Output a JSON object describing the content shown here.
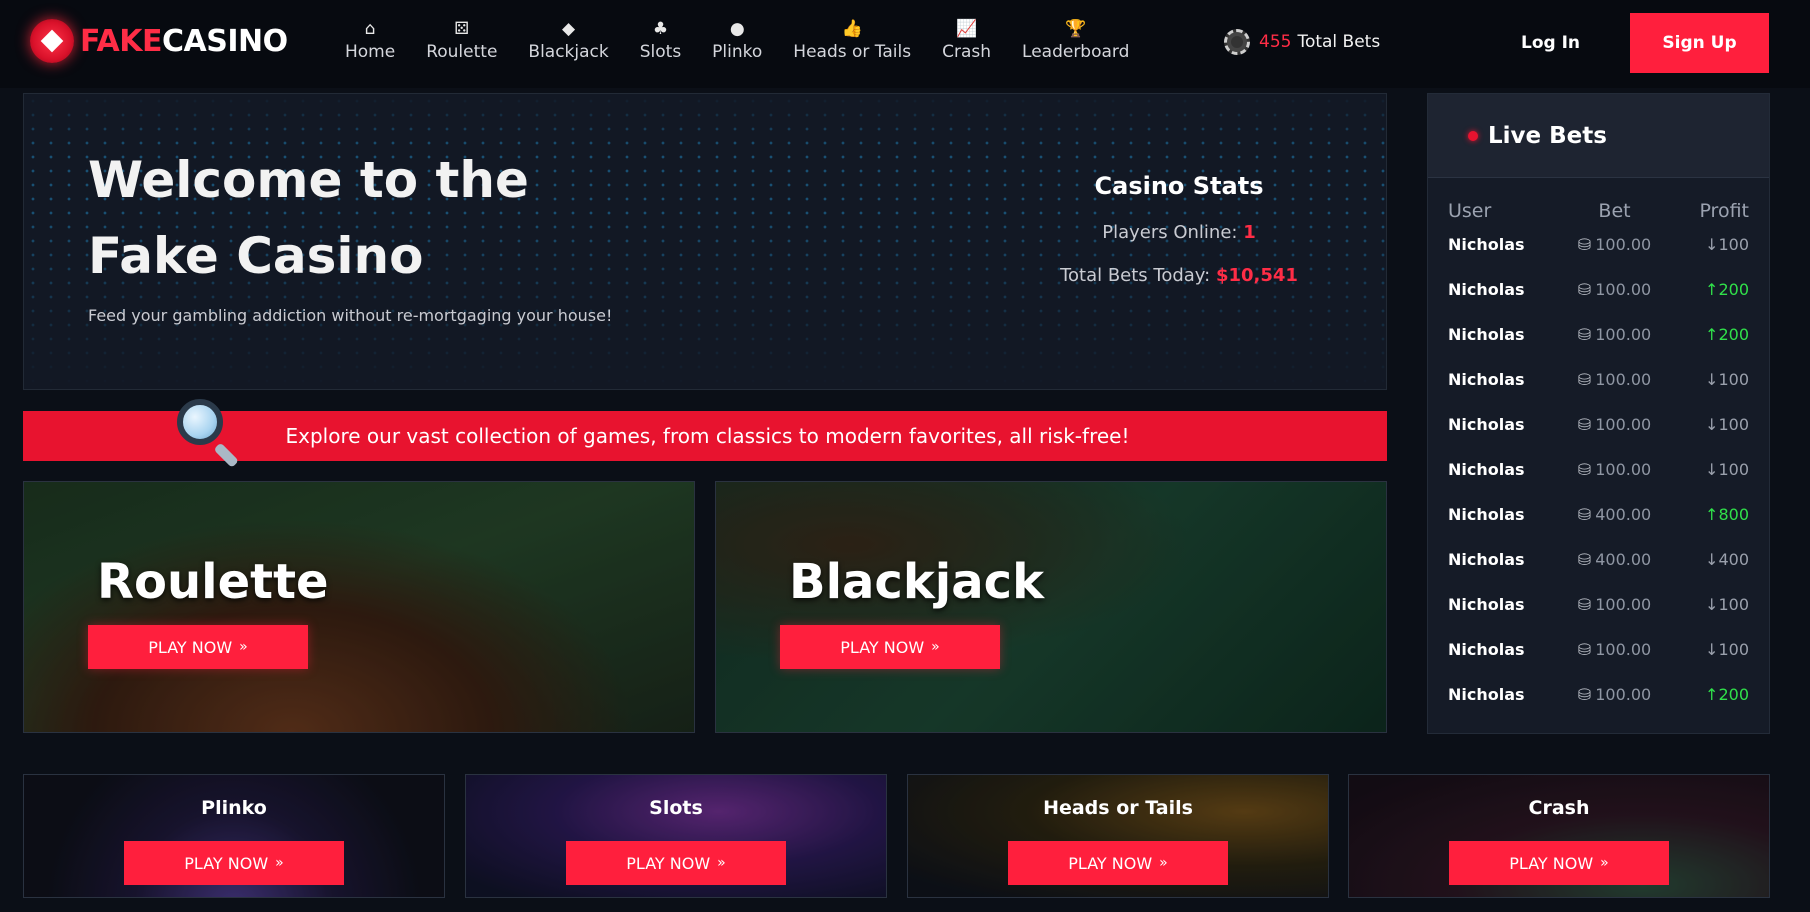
{
  "brand": {
    "part1": "FAKE",
    "part2": "CASINO"
  },
  "nav": [
    {
      "icon": "home-icon",
      "glyph": "⌂",
      "label": "Home"
    },
    {
      "icon": "dice-icon",
      "glyph": "⚄",
      "label": "Roulette"
    },
    {
      "icon": "diamond-icon",
      "glyph": "◆",
      "label": "Blackjack"
    },
    {
      "icon": "club-icon",
      "glyph": "♣",
      "label": "Slots"
    },
    {
      "icon": "circle-icon",
      "glyph": "●",
      "label": "Plinko"
    },
    {
      "icon": "thumbs-up-icon",
      "glyph": "👍",
      "label": "Heads or Tails"
    },
    {
      "icon": "chart-icon",
      "glyph": "📈",
      "label": "Crash"
    },
    {
      "icon": "trophy-icon",
      "glyph": "🏆",
      "label": "Leaderboard"
    }
  ],
  "header": {
    "total_bets_count": "455",
    "total_bets_label": "Total Bets",
    "login_label": "Log In",
    "signup_label": "Sign Up"
  },
  "hero": {
    "title": "Welcome to the Fake Casino",
    "subtitle": "Feed your gambling addiction without re-mortgaging your house!",
    "stats_title": "Casino Stats",
    "players_online_label": "Players Online:",
    "players_online_value": "1",
    "total_bets_today_label": "Total Bets Today:",
    "total_bets_today_value": "$10,541"
  },
  "banner": {
    "text": "Explore our vast collection of games, from classics to modern favorites, all risk-free!"
  },
  "features": [
    {
      "title": "Roulette",
      "button": "PLAY NOW"
    },
    {
      "title": "Blackjack",
      "button": "PLAY NOW"
    }
  ],
  "games": [
    {
      "title": "Plinko",
      "button": "PLAY NOW"
    },
    {
      "title": "Slots",
      "button": "PLAY NOW"
    },
    {
      "title": "Heads or Tails",
      "button": "PLAY NOW"
    },
    {
      "title": "Crash",
      "button": "PLAY NOW"
    }
  ],
  "live_bets": {
    "title": "Live Bets",
    "columns": [
      "User",
      "Bet",
      "Profit"
    ],
    "rows": [
      {
        "user": "Nicholas",
        "bet": "100.00",
        "profit": "100",
        "direction": "down"
      },
      {
        "user": "Nicholas",
        "bet": "100.00",
        "profit": "200",
        "direction": "up"
      },
      {
        "user": "Nicholas",
        "bet": "100.00",
        "profit": "200",
        "direction": "up"
      },
      {
        "user": "Nicholas",
        "bet": "100.00",
        "profit": "100",
        "direction": "down"
      },
      {
        "user": "Nicholas",
        "bet": "100.00",
        "profit": "100",
        "direction": "down"
      },
      {
        "user": "Nicholas",
        "bet": "100.00",
        "profit": "100",
        "direction": "down"
      },
      {
        "user": "Nicholas",
        "bet": "400.00",
        "profit": "800",
        "direction": "up"
      },
      {
        "user": "Nicholas",
        "bet": "400.00",
        "profit": "400",
        "direction": "down"
      },
      {
        "user": "Nicholas",
        "bet": "100.00",
        "profit": "100",
        "direction": "down"
      },
      {
        "user": "Nicholas",
        "bet": "100.00",
        "profit": "100",
        "direction": "down"
      },
      {
        "user": "Nicholas",
        "bet": "100.00",
        "profit": "200",
        "direction": "up"
      }
    ]
  },
  "colors": {
    "accent": "#ff1f3d",
    "up": "#30e04a",
    "down": "#9aa0ac",
    "background": "#0b0f17"
  }
}
